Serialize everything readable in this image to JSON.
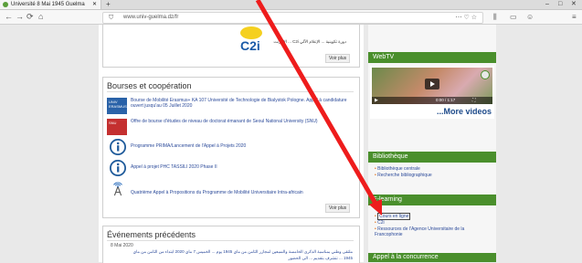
{
  "browser": {
    "tab_title": "Université 8 Mai 1945 Guelma",
    "tab_close": "✕",
    "new_tab": "+",
    "url": "www.univ-guelma.dz/fr",
    "url_icons": "⋯ ♡ ☆",
    "window_controls": [
      "–",
      "□",
      "✕"
    ],
    "nav": [
      "←",
      "→",
      "⟳",
      "⌂"
    ]
  },
  "top_box": {
    "arabic_text": "دورة تكوينية ... الإعلام الآلي C2i ... الانترنت",
    "logo_text": "C2i",
    "voir_plus": "Voir plus"
  },
  "bourses": {
    "title": "Bourses et coopération",
    "items": [
      {
        "text": "Bourse de Mobilité Erasmus+ KA 107 Université de Technologie de Bialystok Pologne. Appel à candidature ouvert jusqu'au 05 Juillet 2020",
        "icon": "erasmus-logo"
      },
      {
        "text": "Offre de bourse d'études de niveau de doctorat émanant de Seoul National University (SNU)",
        "icon": "snu-logo"
      },
      {
        "text": "Programme PRIMA/Lancement de l'Appel à Projets 2020",
        "icon": "info-icon"
      },
      {
        "text": "Appel à projet PHC TASSILI 2020 Phase II",
        "icon": "info-icon"
      },
      {
        "text": "Quatrième Appel à Propositions du Programme de Mobilité Universitaire Intra-africain",
        "icon": "wifi-tower-icon"
      }
    ],
    "voir_plus": "Voir plus"
  },
  "events": {
    "title": "Événements précédents",
    "date": "8 Mai 2020",
    "text1": "ملتقى وطني بمناسبة الذكرى الخامسة والسبعين لمجازر الثامن من ماي 1945 يوم ... الخميس 7 ماي 2020 ابتداء من الثامن من ماي",
    "text2": "1945 ... نتشرف بتقديم ... الى الحضور"
  },
  "right": {
    "webtv_title": "WebTV",
    "video_time": "0:00 / 1:17",
    "more_videos": "...More videos",
    "biblio_title": "Bibliothèque",
    "biblio_items": [
      "Bibliothèque centrale",
      "Recherche bibliographique"
    ],
    "elearning_title": "E-learning",
    "elearning_items": [
      "Cours en ligne",
      "C2i",
      "Ressources de l'Agence Universitaire de la Francophonie"
    ],
    "concurrence_title": "Appel à la concurrence"
  },
  "colors": {
    "accent_green": "#4a8f2c",
    "arrow": "#ee1c1c",
    "link": "#2b4a9a"
  }
}
